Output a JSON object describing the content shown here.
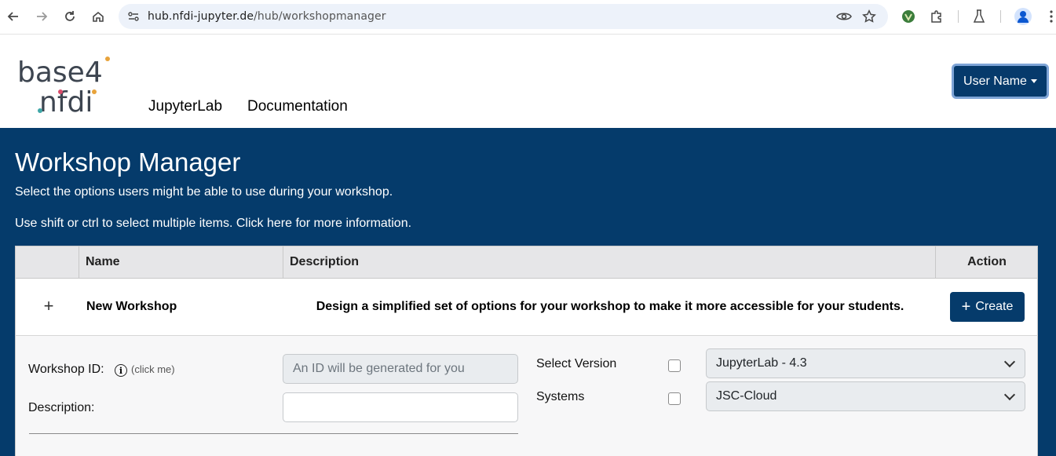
{
  "browser": {
    "url_host": "hub.nfdi-jupyter.de",
    "url_path": "/hub/workshopmanager",
    "icons": [
      "back-icon",
      "forward-icon",
      "reload-icon",
      "home-icon",
      "site-info-icon",
      "eye-icon",
      "star-icon",
      "extension-icon",
      "puzzle-icon",
      "labs-icon",
      "profile-icon",
      "menu-icon"
    ]
  },
  "header": {
    "logo_top": "base4",
    "logo_bottom": "nfdi",
    "nav": [
      "JupyterLab",
      "Documentation"
    ],
    "user_button": "User Name"
  },
  "main": {
    "title": "Workshop Manager",
    "subtitle": "Select the options users might be able to use during your workshop.",
    "hint": "Use shift or ctrl to select multiple items. Click here for more information."
  },
  "table": {
    "columns": [
      "",
      "Name",
      "Description",
      "Action"
    ],
    "row": {
      "expand": "+",
      "name": "New Workshop",
      "description": "Design a simplified set of options for your workshop to make it more accessible for your students.",
      "action": "Create"
    }
  },
  "form": {
    "workshop_id_label": "Workshop ID:",
    "click_me": "(click me)",
    "workshop_id_placeholder": "An ID will be generated for you",
    "description_label": "Description:",
    "description_value": "",
    "version_label": "Select Version",
    "version_value": "JupyterLab - 4.3",
    "systems_label": "Systems",
    "systems_value": "JSC-Cloud"
  }
}
